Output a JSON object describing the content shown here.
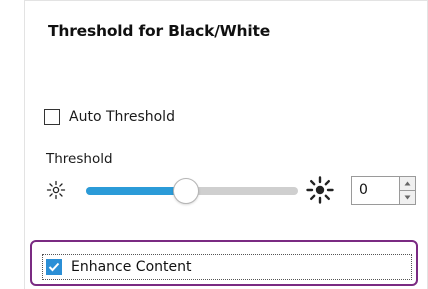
{
  "panel": {
    "title": "Threshold for Black/White"
  },
  "auto_threshold": {
    "label": "Auto Threshold",
    "checked": false
  },
  "threshold": {
    "label": "Threshold",
    "slider_fraction": 0.47,
    "value": "0",
    "decrease_icon": "sun-dim-icon",
    "increase_icon": "sun-bright-icon"
  },
  "enhance_content": {
    "label": "Enhance Content",
    "checked": true
  },
  "colors": {
    "accent": "#2b9bd8",
    "checkbox_checked": "#2b8fd6",
    "highlight_border": "#7a2a82",
    "track": "#cfcfcf"
  }
}
